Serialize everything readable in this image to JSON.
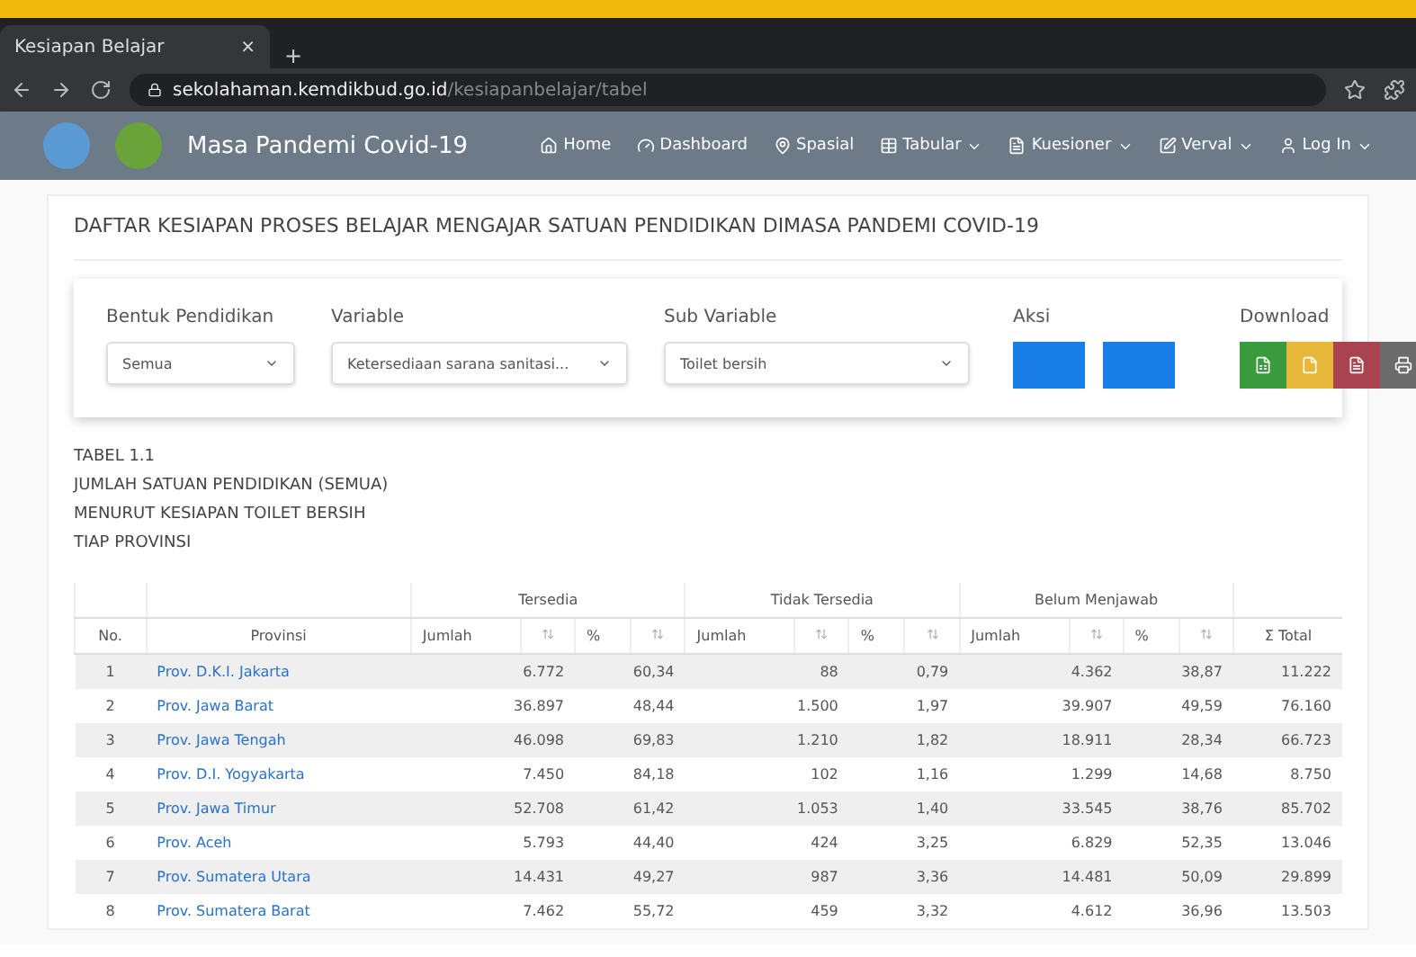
{
  "browser": {
    "tab_title": "Kesiapan Belajar",
    "new_tab": "+",
    "close_tab": "×",
    "url_host": "sekolahaman.kemdikbud.go.id",
    "url_path": "/kesiapanbelajar/tabel"
  },
  "navbar": {
    "brand": "Masa Pandemi Covid-19",
    "items": [
      {
        "label": "Home",
        "dropdown": false
      },
      {
        "label": "Dashboard",
        "dropdown": false
      },
      {
        "label": "Spasial",
        "dropdown": false
      },
      {
        "label": "Tabular",
        "dropdown": true
      },
      {
        "label": "Kuesioner",
        "dropdown": true
      },
      {
        "label": "Verval",
        "dropdown": true
      },
      {
        "label": "Log In",
        "dropdown": true
      }
    ]
  },
  "page_title": "DAFTAR KESIAPAN PROSES BELAJAR MENGAJAR SATUAN PENDIDIKAN DIMASA PANDEMI COVID-19",
  "filters": [
    {
      "label": "Bentuk Pendidikan",
      "value": "Semua"
    },
    {
      "label": "Variable",
      "value": "Ketersediaan sarana sanitasi..."
    },
    {
      "label": "Sub Variable",
      "value": "Toilet bersih"
    }
  ],
  "actions_label": "Aksi",
  "download_label": "Download",
  "downloads": [
    {
      "color": "#3a9b3e"
    },
    {
      "color": "#e8b83a"
    },
    {
      "color": "#a8434f"
    },
    {
      "color": "#6b6b6b"
    }
  ],
  "caption": [
    "TABEL 1.1",
    "JUMLAH SATUAN PENDIDIKAN (SEMUA)",
    "MENURUT KESIAPAN TOILET BERSIH",
    "TIAP PROVINSI"
  ],
  "table": {
    "groups": [
      {
        "label": "Tersedia",
        "columns": [
          "Jumlah",
          "%"
        ]
      },
      {
        "label": "Tidak Tersedia",
        "columns": [
          "Jumlah",
          "%"
        ]
      },
      {
        "label": "Belum Menjawab",
        "columns": [
          "Jumlah",
          "%"
        ]
      }
    ],
    "no_header": "No.",
    "province_header": "Provinsi",
    "total_header": "Σ Total",
    "rows": [
      [
        "1",
        "Prov. D.K.I. Jakarta",
        "6.772",
        "60,34",
        "88",
        "0,79",
        "4.362",
        "38,87",
        "11.222"
      ],
      [
        "2",
        "Prov. Jawa Barat",
        "36.897",
        "48,44",
        "1.500",
        "1,97",
        "39.907",
        "49,59",
        "76.160"
      ],
      [
        "3",
        "Prov. Jawa Tengah",
        "46.098",
        "69,83",
        "1.210",
        "1,82",
        "18.911",
        "28,34",
        "66.723"
      ],
      [
        "4",
        "Prov. D.I. Yogyakarta",
        "7.450",
        "84,18",
        "102",
        "1,16",
        "1.299",
        "14,68",
        "8.750"
      ],
      [
        "5",
        "Prov. Jawa Timur",
        "52.708",
        "61,42",
        "1.053",
        "1,40",
        "33.545",
        "38,76",
        "85.702"
      ],
      [
        "6",
        "Prov. Aceh",
        "5.793",
        "44,40",
        "424",
        "3,25",
        "6.829",
        "52,35",
        "13.046"
      ],
      [
        "7",
        "Prov. Sumatera Utara",
        "14.431",
        "49,27",
        "987",
        "3,36",
        "14.481",
        "50,09",
        "29.899"
      ],
      [
        "8",
        "Prov. Sumatera Barat",
        "7.462",
        "55,72",
        "459",
        "3,32",
        "4.612",
        "36,96",
        "13.503"
      ]
    ]
  }
}
